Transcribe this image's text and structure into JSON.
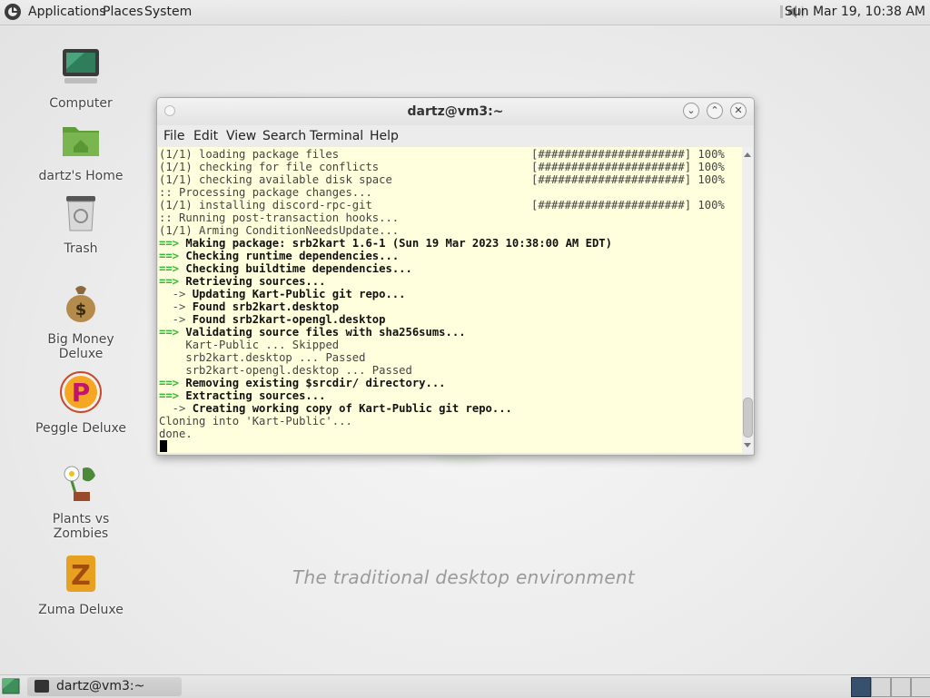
{
  "top_panel": {
    "menus": [
      "Applications",
      "Places",
      "System"
    ],
    "clock": "Sun Mar 19, 10:38 AM"
  },
  "desktop": {
    "icons": [
      {
        "label": "Computer"
      },
      {
        "label": "dartz's Home"
      },
      {
        "label": "Trash"
      },
      {
        "label": "Big Money Deluxe"
      },
      {
        "label": "Peggle Deluxe"
      },
      {
        "label": "Plants vs Zombies"
      },
      {
        "label": "Zuma Deluxe"
      }
    ],
    "watermark": "The traditional desktop environment"
  },
  "terminal": {
    "title": "dartz@vm3:~",
    "menu": [
      "File",
      "Edit",
      "View",
      "Search",
      "Terminal",
      "Help"
    ],
    "progress_bar": "[######################] 100%",
    "lines": [
      {
        "prefix": "",
        "text": "(1/1) loading package files",
        "bold": false,
        "progress": true
      },
      {
        "prefix": "",
        "text": "(1/1) checking for file conflicts",
        "bold": false,
        "progress": true
      },
      {
        "prefix": "",
        "text": "(1/1) checking available disk space",
        "bold": false,
        "progress": true
      },
      {
        "prefix": "",
        "text": ":: Processing package changes...",
        "bold": false,
        "progress": false
      },
      {
        "prefix": "",
        "text": "(1/1) installing discord-rpc-git",
        "bold": false,
        "progress": true
      },
      {
        "prefix": "",
        "text": ":: Running post-transaction hooks...",
        "bold": false,
        "progress": false
      },
      {
        "prefix": "",
        "text": "(1/1) Arming ConditionNeedsUpdate...",
        "bold": false,
        "progress": false
      },
      {
        "prefix": "==> ",
        "text": "Making package: srb2kart 1.6-1 (Sun 19 Mar 2023 10:38:00 AM EDT)",
        "bold": true,
        "progress": false
      },
      {
        "prefix": "==> ",
        "text": "Checking runtime dependencies...",
        "bold": true,
        "progress": false
      },
      {
        "prefix": "==> ",
        "text": "Checking buildtime dependencies...",
        "bold": true,
        "progress": false
      },
      {
        "prefix": "==> ",
        "text": "Retrieving sources...",
        "bold": true,
        "progress": false
      },
      {
        "prefix": "  -> ",
        "text": "Updating Kart-Public git repo...",
        "bold": true,
        "progress": false
      },
      {
        "prefix": "  -> ",
        "text": "Found srb2kart.desktop",
        "bold": true,
        "progress": false
      },
      {
        "prefix": "  -> ",
        "text": "Found srb2kart-opengl.desktop",
        "bold": true,
        "progress": false
      },
      {
        "prefix": "==> ",
        "text": "Validating source files with sha256sums...",
        "bold": true,
        "progress": false
      },
      {
        "prefix": "    ",
        "text": "Kart-Public ... Skipped",
        "bold": false,
        "progress": false
      },
      {
        "prefix": "    ",
        "text": "srb2kart.desktop ... Passed",
        "bold": false,
        "progress": false
      },
      {
        "prefix": "    ",
        "text": "srb2kart-opengl.desktop ... Passed",
        "bold": false,
        "progress": false
      },
      {
        "prefix": "==> ",
        "text": "Removing existing $srcdir/ directory...",
        "bold": true,
        "progress": false
      },
      {
        "prefix": "==> ",
        "text": "Extracting sources...",
        "bold": true,
        "progress": false
      },
      {
        "prefix": "  -> ",
        "text": "Creating working copy of Kart-Public git repo...",
        "bold": true,
        "progress": false
      },
      {
        "prefix": "",
        "text": "Cloning into 'Kart-Public'...",
        "bold": false,
        "progress": false
      },
      {
        "prefix": "",
        "text": "done.",
        "bold": false,
        "progress": false
      }
    ]
  },
  "bottom_panel": {
    "task_label": "dartz@vm3:~"
  },
  "colors": {
    "terminal_bg": "#ffffdd",
    "arrow_green": "#2ebd2e",
    "active_workspace": "#36506d"
  }
}
